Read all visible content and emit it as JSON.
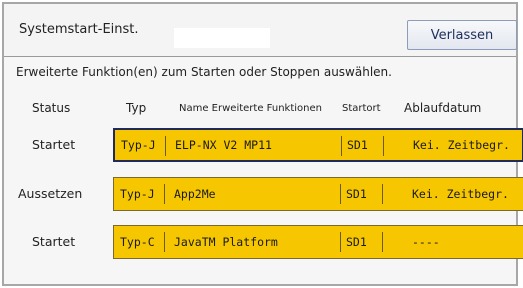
{
  "header": {
    "title": "Systemstart-Einst.",
    "exit_label": "Verlassen"
  },
  "instruction": "Erweiterte Funktion(en) zum Starten oder Stoppen auswählen.",
  "columns": {
    "status": "Status",
    "type": "Typ",
    "name": "Name Erweiterte Funktionen",
    "start": "Startort",
    "expiry": "Ablaufdatum"
  },
  "rows": [
    {
      "status": "Startet",
      "type": "Typ-J",
      "name": "ELP-NX V2 MP11",
      "start": "SD1",
      "expiry": "Kei. Zeitbegr."
    },
    {
      "status": "Aussetzen",
      "type": "Typ-J",
      "name": "App2Me",
      "start": "SD1",
      "expiry": "Kei. Zeitbegr."
    },
    {
      "status": "Startet",
      "type": "Typ-C",
      "name": "JavaTM Platform",
      "start": "SD1",
      "expiry": "----"
    }
  ],
  "colors": {
    "row_background": "#f6c700",
    "selected_border": "#1f2b5c"
  }
}
